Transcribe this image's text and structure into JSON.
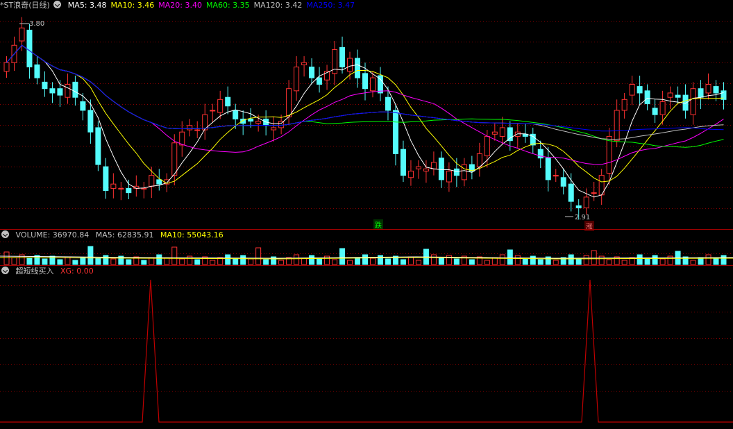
{
  "main_pane": {
    "stock_name": "*ST浪奇",
    "period": "(日线)",
    "ma": [
      {
        "label": "MA5: ",
        "value": "3.48",
        "color": "#ffffff"
      },
      {
        "label": "MA10: ",
        "value": "3.46",
        "color": "#ffff00"
      },
      {
        "label": "MA20: ",
        "value": "3.40",
        "color": "#ff00ff"
      },
      {
        "label": "MA60: ",
        "value": "3.35",
        "color": "#00ff00"
      },
      {
        "label": "MA120: ",
        "value": "3.42",
        "color": "#c0c0c0"
      },
      {
        "label": "MA250: ",
        "value": "3.47",
        "color": "#0000ff"
      }
    ],
    "high_label": "3.80",
    "low_label": "2.91",
    "signal_down": "跌",
    "signal_up": "涨"
  },
  "volume_pane": {
    "label": "VOLUME: ",
    "value": "36970.84",
    "ma5_label": "MA5: ",
    "ma5_value": "62835.91",
    "ma10_label": "MA10: ",
    "ma10_value": "55043.16"
  },
  "indicator_pane": {
    "name": "超短线买入",
    "xg_label": "XG: ",
    "xg_value": "0.00"
  },
  "colors": {
    "up": "#ff3232",
    "down": "#54fcfc",
    "grid": "#8b0000",
    "separator": "#a00000",
    "signal_line": "#c00000"
  },
  "chart_data": {
    "type": "candlestick",
    "price_high": 3.8,
    "price_low": 2.91,
    "volume_ma5": 62835.91,
    "volume_ma10": 55043.16,
    "xg_signals": [
      1,
      0
    ]
  }
}
